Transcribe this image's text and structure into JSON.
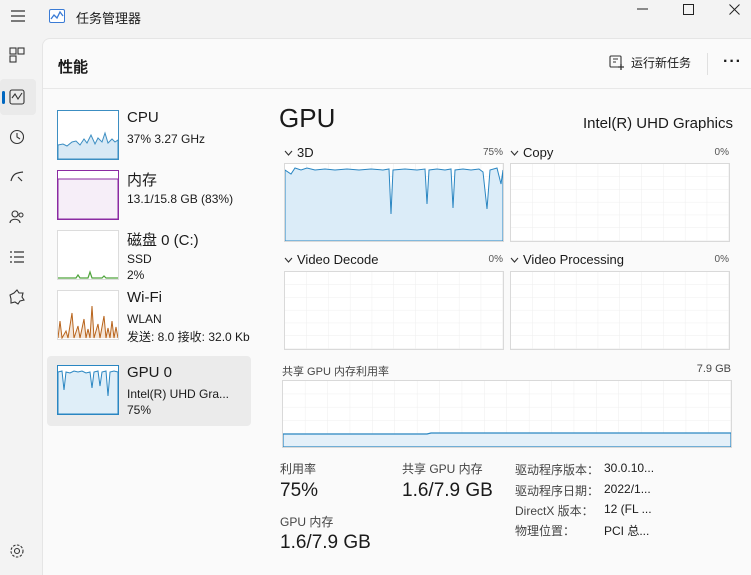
{
  "app": {
    "title": "任务管理器"
  },
  "header": {
    "title": "性能",
    "run_task_label": "运行新任务",
    "more_label": "···"
  },
  "items": [
    {
      "name": "CPU",
      "sub1": "37% 3.27 GHz",
      "sub2": ""
    },
    {
      "name": "内存",
      "sub1": "13.1/15.8 GB (83%)",
      "sub2": ""
    },
    {
      "name": "磁盘 0 (C:)",
      "sub1": "SSD",
      "sub2": "2%"
    },
    {
      "name": "Wi-Fi",
      "sub1": "WLAN",
      "sub2": "发送: 8.0  接收: 32.0 Kb"
    },
    {
      "name": "GPU 0",
      "sub1": "Intel(R) UHD Gra...",
      "sub2": "75%"
    }
  ],
  "detail": {
    "title": "GPU",
    "model": "Intel(R) UHD Graphics",
    "engines": [
      {
        "label": "3D",
        "pct": "75%"
      },
      {
        "label": "Copy",
        "pct": "0%"
      },
      {
        "label": "Video Decode",
        "pct": "0%"
      },
      {
        "label": "Video Processing",
        "pct": "0%"
      }
    ],
    "shared_mem_label": "共享 GPU 内存利用率",
    "shared_mem_max": "7.9 GB",
    "stats": {
      "utilization_label": "利用率",
      "utilization_value": "75%",
      "shared_label": "共享 GPU 内存",
      "shared_value": "1.6/7.9 GB",
      "gpu_mem_label": "GPU 内存",
      "gpu_mem_value": "1.6/7.9 GB"
    },
    "info": [
      {
        "key": "驱动程序版本：",
        "value": "30.0.10..."
      },
      {
        "key": "驱动程序日期：",
        "value": "2022/1..."
      },
      {
        "key": "DirectX 版本：",
        "value": "12 (FL ..."
      },
      {
        "key": "物理位置：",
        "value": "PCI 总..."
      }
    ]
  },
  "colors": {
    "cpu": "#3c8ec2",
    "memory": "#8b2aa2",
    "disk": "#4fa43c",
    "wifi": "#b8641c",
    "gpu": "#2a86c2"
  }
}
